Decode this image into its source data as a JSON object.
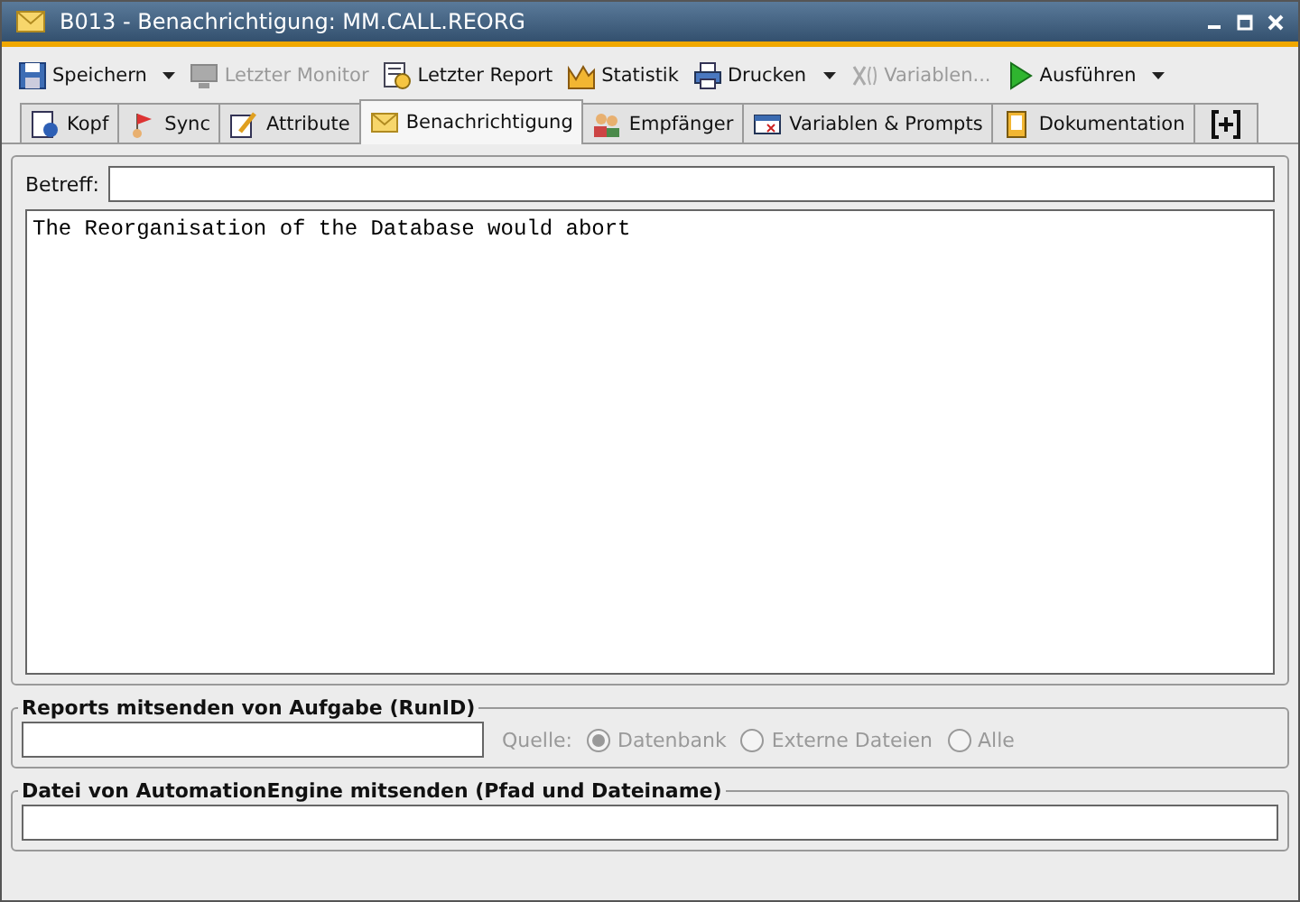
{
  "window": {
    "title": "B013 - Benachrichtigung: MM.CALL.REORG"
  },
  "toolbar": [
    {
      "label": "Speichern",
      "disabled": false,
      "dropdown": true
    },
    {
      "label": "Letzter Monitor",
      "disabled": true,
      "dropdown": false
    },
    {
      "label": "Letzter Report",
      "disabled": false,
      "dropdown": false
    },
    {
      "label": "Statistik",
      "disabled": false,
      "dropdown": false
    },
    {
      "label": "Drucken",
      "disabled": false,
      "dropdown": true
    },
    {
      "label": "Variablen...",
      "disabled": true,
      "dropdown": false
    },
    {
      "label": "Ausführen",
      "disabled": false,
      "dropdown": true
    }
  ],
  "tabs": [
    {
      "label": "Kopf",
      "selected": false
    },
    {
      "label": "Sync",
      "selected": false
    },
    {
      "label": "Attribute",
      "selected": false
    },
    {
      "label": "Benachrichtigung",
      "selected": true
    },
    {
      "label": "Empfänger",
      "selected": false
    },
    {
      "label": "Variablen & Prompts",
      "selected": false
    },
    {
      "label": "Dokumentation",
      "selected": false
    }
  ],
  "subject": {
    "label": "Betreff:"
  },
  "body": "The Reorganisation of the Database would abort",
  "reports": {
    "title": "Reports mitsenden von Aufgabe (RunID)",
    "source_label": "Quelle:",
    "options": [
      {
        "label": "Datenbank",
        "selected": true,
        "disabled": true
      },
      {
        "label": "Externe Dateien",
        "selected": false,
        "disabled": true
      },
      {
        "label": "Alle",
        "selected": false,
        "disabled": true
      }
    ]
  },
  "file": {
    "title": "Datei von AutomationEngine mitsenden (Pfad und Dateiname)"
  }
}
